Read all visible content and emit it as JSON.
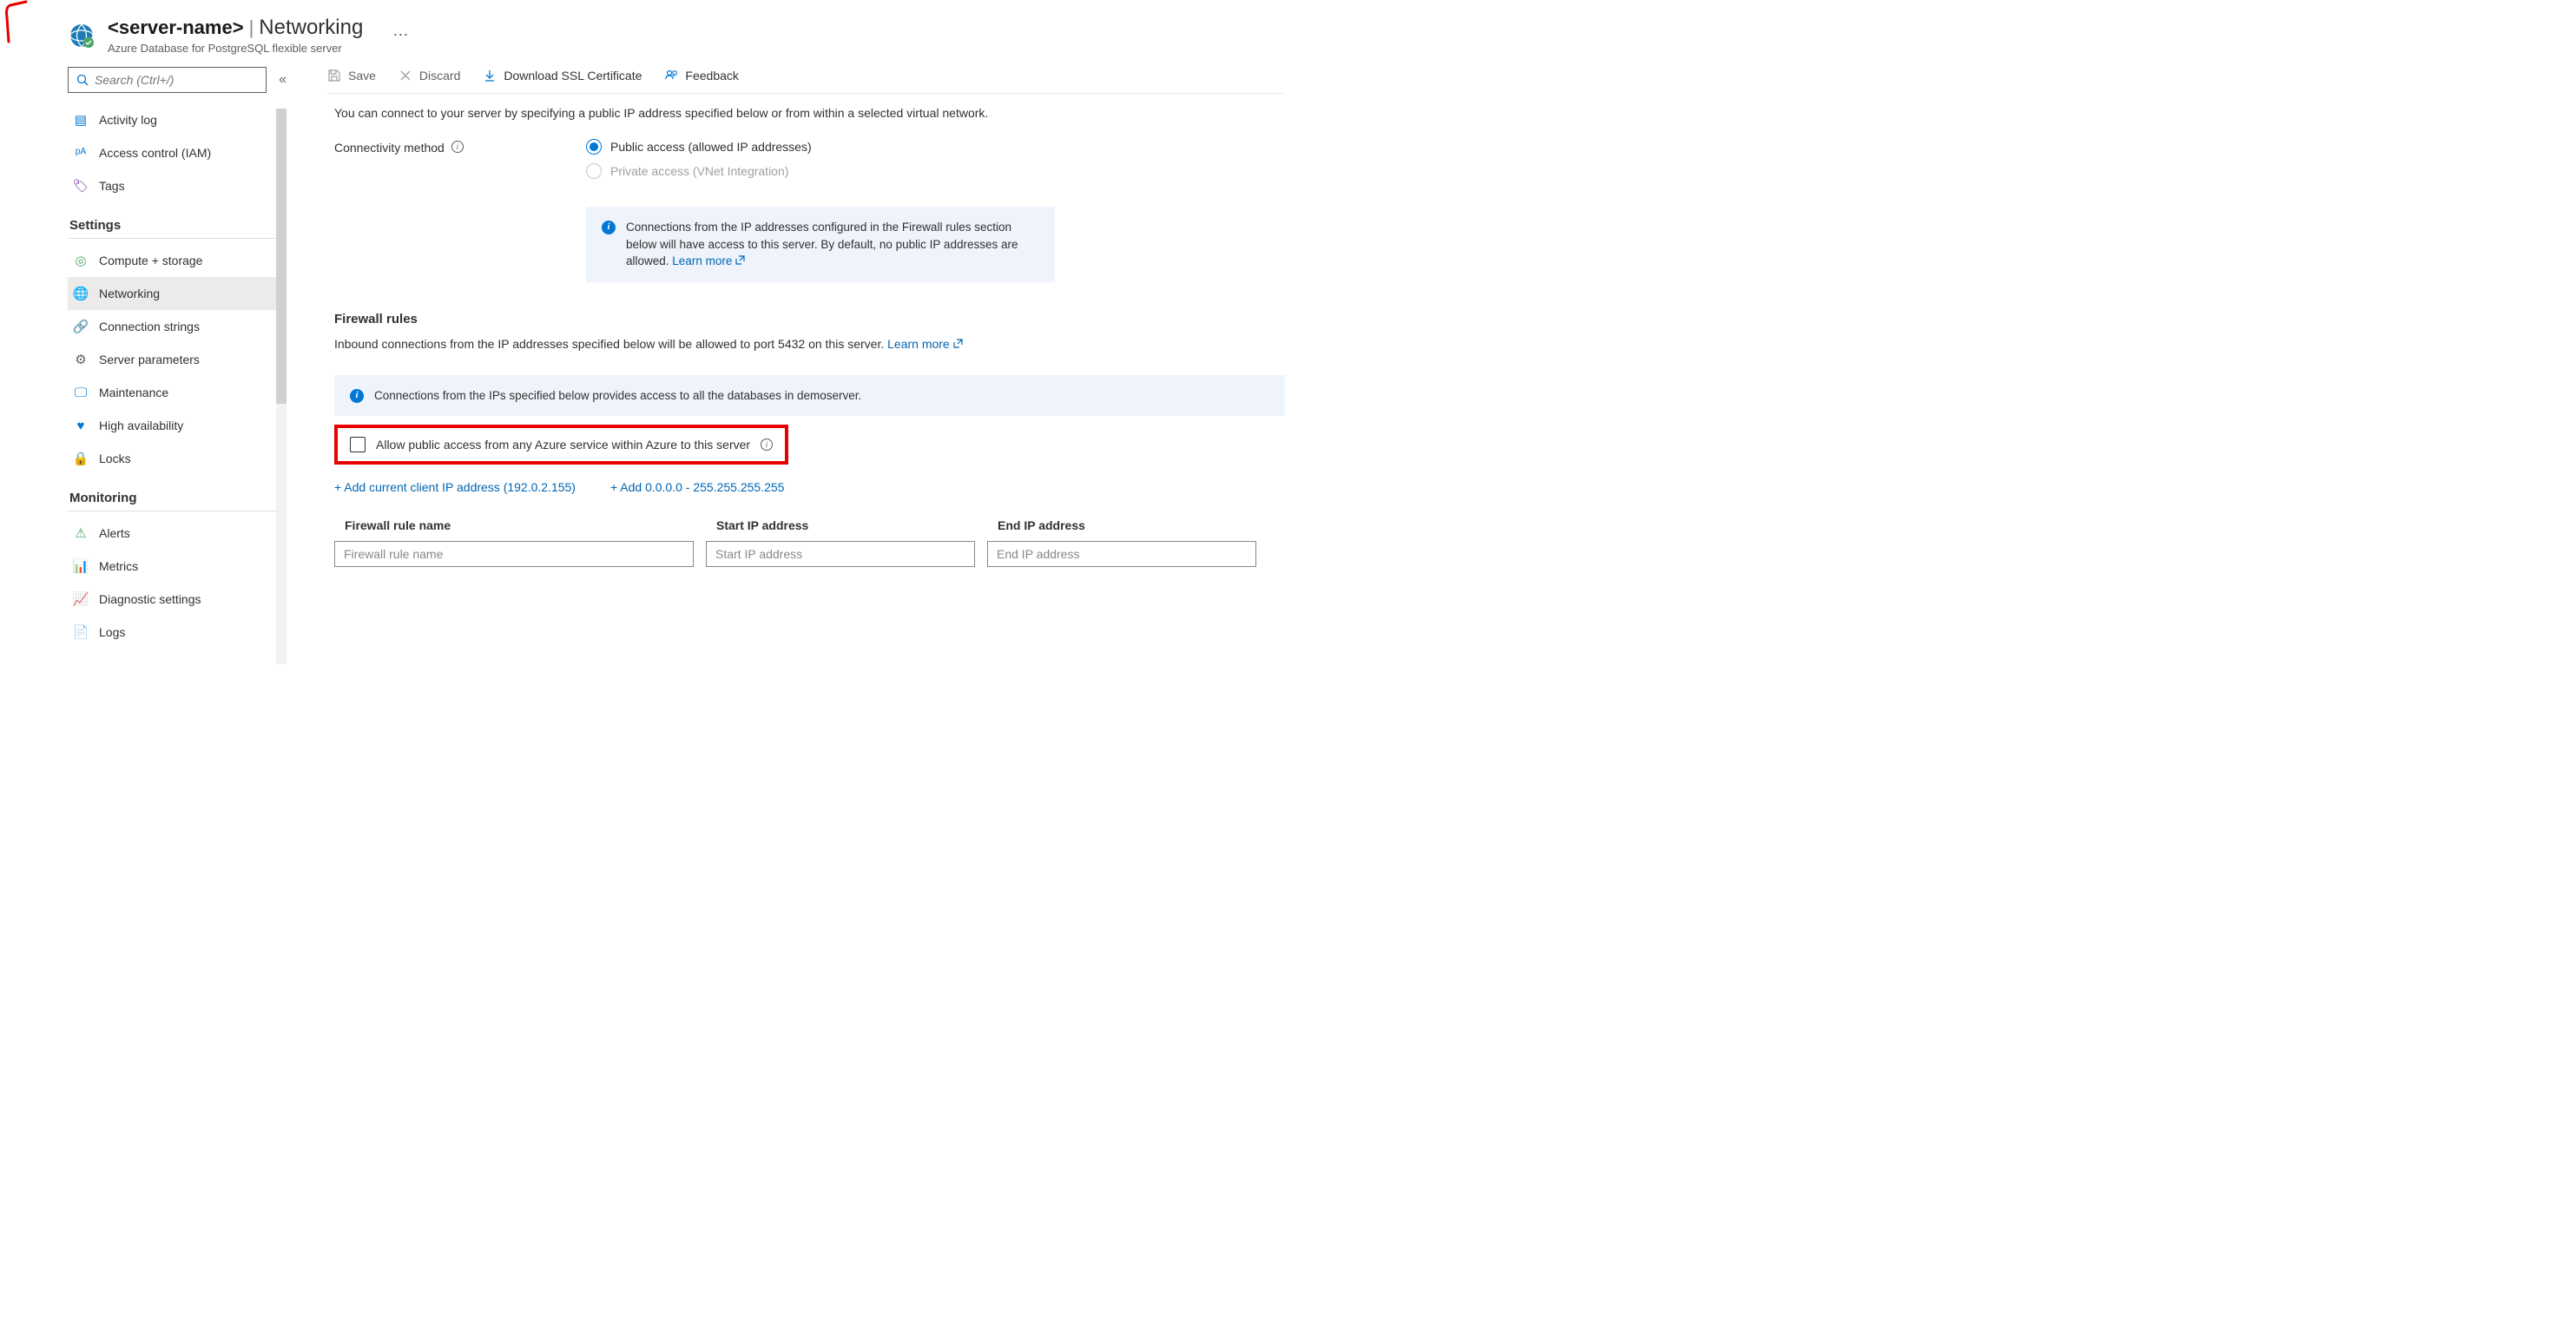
{
  "header": {
    "server_name": "<server-name>",
    "section": "Networking",
    "subtitle": "Azure Database for PostgreSQL flexible server",
    "more": "⋯"
  },
  "sidebar": {
    "search_placeholder": "Search (Ctrl+/)",
    "items_top": [
      {
        "icon": "activity-log-icon",
        "glyph": "▤",
        "color": "#0078d4",
        "label": "Activity log"
      },
      {
        "icon": "access-control-icon",
        "glyph": "ᵖᴬ",
        "color": "#0078d4",
        "label": "Access control (IAM)"
      },
      {
        "icon": "tags-icon",
        "glyph": "🏷",
        "color": "#7030a0",
        "label": "Tags"
      }
    ],
    "group_settings": "Settings",
    "items_settings": [
      {
        "icon": "compute-storage-icon",
        "glyph": "◎",
        "color": "#4aa564",
        "label": "Compute + storage"
      },
      {
        "icon": "networking-icon",
        "glyph": "🌐",
        "color": "#0078d4",
        "label": "Networking",
        "selected": true
      },
      {
        "icon": "connection-strings-icon",
        "glyph": "🔗",
        "color": "#605e5c",
        "label": "Connection strings"
      },
      {
        "icon": "server-parameters-icon",
        "glyph": "⚙",
        "color": "#605e5c",
        "label": "Server parameters"
      },
      {
        "icon": "maintenance-icon",
        "glyph": "🖵",
        "color": "#0078d4",
        "label": "Maintenance"
      },
      {
        "icon": "high-availability-icon",
        "glyph": "♥",
        "color": "#0078d4",
        "label": "High availability"
      },
      {
        "icon": "locks-icon",
        "glyph": "🔒",
        "color": "#0078d4",
        "label": "Locks"
      }
    ],
    "group_monitoring": "Monitoring",
    "items_monitoring": [
      {
        "icon": "alerts-icon",
        "glyph": "⚠",
        "color": "#4aa564",
        "label": "Alerts"
      },
      {
        "icon": "metrics-icon",
        "glyph": "📊",
        "color": "#0078d4",
        "label": "Metrics"
      },
      {
        "icon": "diagnostic-settings-icon",
        "glyph": "📈",
        "color": "#4aa564",
        "label": "Diagnostic settings"
      },
      {
        "icon": "logs-icon",
        "glyph": "📄",
        "color": "#0078d4",
        "label": "Logs"
      }
    ]
  },
  "toolbar": {
    "save": "Save",
    "discard": "Discard",
    "download_ssl": "Download SSL Certificate",
    "feedback": "Feedback"
  },
  "main": {
    "intro": "You can connect to your server by specifying a public IP address specified below or from within a selected virtual network.",
    "connectivity_label": "Connectivity method",
    "radio_public": "Public access (allowed IP addresses)",
    "radio_private": "Private access (VNet Integration)",
    "info1": "Connections from the IP addresses configured in the Firewall rules section below will have access to this server. By default, no public IP addresses are allowed. ",
    "learn_more": "Learn more",
    "firewall_heading": "Firewall rules",
    "firewall_desc": "Inbound connections from the IP addresses specified below will be allowed to port 5432 on this server. ",
    "info2": "Connections from the IPs specified below provides access to all the databases in demoserver.",
    "allow_azure": "Allow public access from any Azure service within Azure to this server",
    "add_client_ip": "+ Add current client IP address (192.0.2.155)",
    "add_range": "+ Add 0.0.0.0 - 255.255.255.255",
    "col_rule": "Firewall rule name",
    "col_start": "Start IP address",
    "col_end": "End IP address",
    "ph_rule": "Firewall rule name",
    "ph_start": "Start IP address",
    "ph_end": "End IP address"
  }
}
